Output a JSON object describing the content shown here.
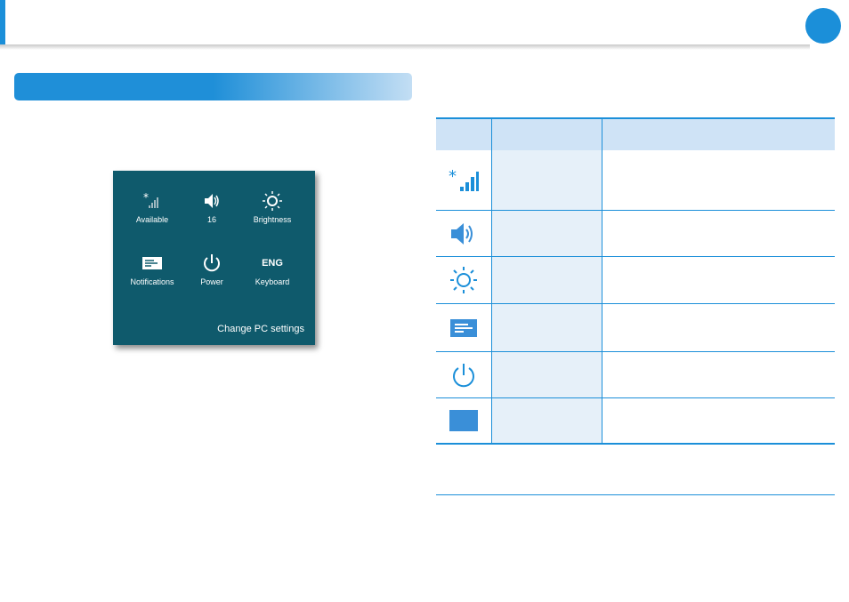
{
  "panel": {
    "tiles": [
      {
        "icon": "wifi-available-icon",
        "label": "Available"
      },
      {
        "icon": "volume-icon",
        "label": "16"
      },
      {
        "icon": "brightness-icon",
        "label": "Brightness"
      },
      {
        "icon": "notifications-icon",
        "label": "Notifications"
      },
      {
        "icon": "power-icon",
        "label": "Power"
      },
      {
        "icon": "keyboard-language",
        "text": "ENG",
        "label": "Keyboard"
      }
    ],
    "link": "Change PC settings"
  },
  "colors": {
    "accent": "#1b8fd9",
    "panel_bg": "#0f5a6c",
    "table_header_bg": "#cfe3f6",
    "table_cell_bg": "#e6f0f9"
  },
  "table": {
    "row_icons": [
      "network-icon",
      "volume-icon",
      "brightness-icon",
      "notifications-icon",
      "power-icon",
      "keyboard-icon"
    ]
  }
}
